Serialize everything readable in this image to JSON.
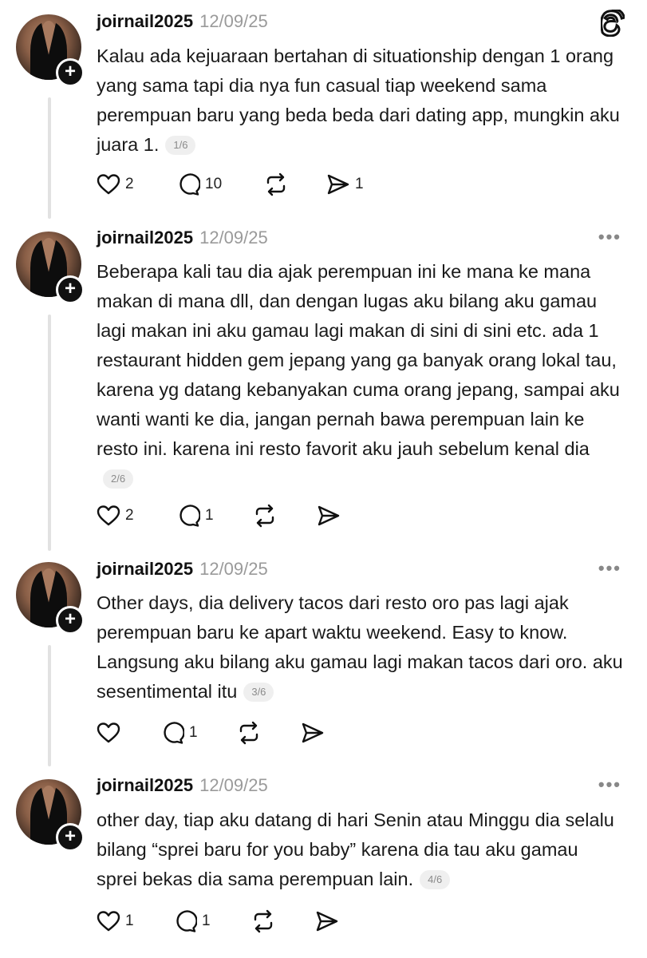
{
  "app": {
    "logo_icon": "threads-logo-icon"
  },
  "posts": [
    {
      "username": "joirnail2025",
      "date": "12/09/25",
      "text": "Kalau ada kejuaraan bertahan di situationship dengan 1 orang yang sama tapi dia nya fun casual tiap weekend sama perempuan baru yang beda beda dari dating app, mungkin aku juara 1.",
      "pager": "1/6",
      "likes": "2",
      "replies": "10",
      "reposts": "",
      "shares": "1"
    },
    {
      "username": "joirnail2025",
      "date": "12/09/25",
      "text": "Beberapa kali tau dia ajak perempuan ini ke mana ke mana makan di mana dll, dan dengan lugas aku bilang aku gamau lagi makan ini aku gamau lagi makan di sini di sini etc. ada 1 restaurant hidden gem jepang yang ga banyak orang lokal tau, karena yg datang kebanyakan cuma orang jepang, sampai aku wanti wanti ke dia, jangan pernah bawa perempuan lain ke resto ini. karena ini resto favorit aku jauh sebelum kenal dia",
      "pager": "2/6",
      "likes": "2",
      "replies": "1",
      "reposts": "",
      "shares": ""
    },
    {
      "username": "joirnail2025",
      "date": "12/09/25",
      "text": "Other days, dia delivery tacos dari resto oro pas lagi ajak perempuan baru ke apart waktu weekend. Easy to know. Langsung aku bilang aku gamau lagi makan tacos dari oro. aku sesentimental itu",
      "pager": "3/6",
      "likes": "",
      "replies": "1",
      "reposts": "",
      "shares": ""
    },
    {
      "username": "joirnail2025",
      "date": "12/09/25",
      "text": "other day, tiap aku datang di hari Senin atau Minggu dia selalu bilang “sprei baru for you baby” karena dia tau aku gamau sprei bekas dia sama perempuan lain.",
      "pager": "4/6",
      "likes": "1",
      "replies": "1",
      "reposts": "",
      "shares": ""
    }
  ]
}
